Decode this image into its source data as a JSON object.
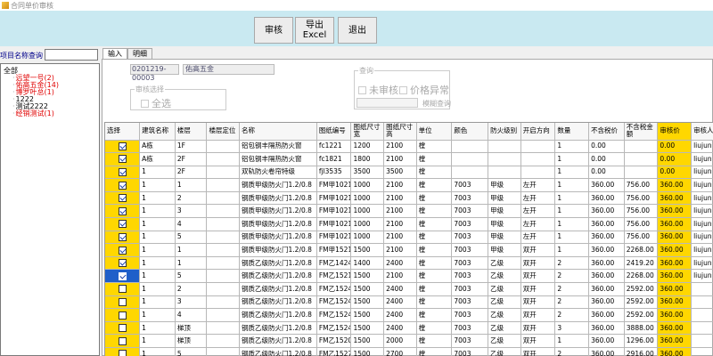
{
  "window": {
    "title": "合同单价审核"
  },
  "toolbar": {
    "audit": "审核",
    "export": "导出\nExcel",
    "exit": "退出"
  },
  "sidebar": {
    "query_label": "项目名称查询",
    "query_value": "",
    "tree": [
      {
        "label": "全部",
        "red": false,
        "level": 0
      },
      {
        "label": "远望一号(2)",
        "red": true,
        "level": 1
      },
      {
        "label": "佑高五金(14)",
        "red": true,
        "level": 1
      },
      {
        "label": "博罗叶总(1)",
        "red": true,
        "level": 1
      },
      {
        "label": "1222",
        "red": false,
        "level": 1
      },
      {
        "label": "测试2222",
        "red": false,
        "level": 1
      },
      {
        "label": "经销测试(1)",
        "red": true,
        "level": 1
      }
    ]
  },
  "tabs": [
    {
      "label": "输入",
      "active": true
    },
    {
      "label": "明细",
      "active": false
    }
  ],
  "form": {
    "contract_code": "0201219-00003",
    "project_name": "佑高五金",
    "audit_group": "审核选择",
    "select_all": "全选",
    "query_group": "查询",
    "unaudited": "未审核",
    "price_abnormal": "价格异常",
    "fuzzy_query": "模糊查询"
  },
  "grid": {
    "columns": [
      "选择",
      "建筑名称",
      "楼层",
      "楼层定位",
      "名称",
      "图纸编号",
      "图纸尺寸宽",
      "图纸尺寸高",
      "单位",
      "颜色",
      "防火级别",
      "开启方向",
      "数量",
      "不含税价",
      "不含税金额",
      "审核价",
      "审核人"
    ],
    "rows": [
      {
        "checked": true,
        "selected": false,
        "cells": [
          "A栋",
          "1F",
          "",
          "铝包钢丰隔热防火窗",
          "fc1221",
          "1200",
          "2100",
          "樘",
          "",
          "",
          "",
          "1",
          "0.00",
          "",
          "0.00",
          "liujun"
        ]
      },
      {
        "checked": true,
        "selected": false,
        "cells": [
          "A栋",
          "2F",
          "",
          "铝包钢丰隔热防火窗",
          "fc1821",
          "1800",
          "2100",
          "樘",
          "",
          "",
          "",
          "1",
          "0.00",
          "",
          "0.00",
          "liujun"
        ]
      },
      {
        "checked": true,
        "selected": false,
        "cells": [
          "1",
          "2F",
          "",
          "双轨防火卷帘特级",
          "fjl3535",
          "3500",
          "3500",
          "樘",
          "",
          "",
          "",
          "1",
          "0.00",
          "",
          "0.00",
          "liujun"
        ]
      },
      {
        "checked": true,
        "selected": false,
        "cells": [
          "1",
          "1",
          "",
          "钢质甲级防火门1.2/0.8",
          "FM甲1021",
          "1000",
          "2100",
          "樘",
          "7003",
          "甲级",
          "左开",
          "1",
          "360.00",
          "756.00",
          "360.00",
          "liujun"
        ]
      },
      {
        "checked": true,
        "selected": false,
        "cells": [
          "1",
          "2",
          "",
          "钢质甲级防火门1.2/0.8",
          "FM甲1021",
          "1000",
          "2100",
          "樘",
          "7003",
          "甲级",
          "左开",
          "1",
          "360.00",
          "756.00",
          "360.00",
          "liujun"
        ]
      },
      {
        "checked": true,
        "selected": false,
        "cells": [
          "1",
          "3",
          "",
          "钢质甲级防火门1.2/0.8",
          "FM甲1021",
          "1000",
          "2100",
          "樘",
          "7003",
          "甲级",
          "左开",
          "1",
          "360.00",
          "756.00",
          "360.00",
          "liujun"
        ]
      },
      {
        "checked": true,
        "selected": false,
        "cells": [
          "1",
          "4",
          "",
          "钢质甲级防火门1.2/0.8",
          "FM甲1021",
          "1000",
          "2100",
          "樘",
          "7003",
          "甲级",
          "左开",
          "1",
          "360.00",
          "756.00",
          "360.00",
          "liujun"
        ]
      },
      {
        "checked": true,
        "selected": false,
        "cells": [
          "1",
          "5",
          "",
          "钢质甲级防火门1.2/0.8",
          "FM甲1021",
          "1000",
          "2100",
          "樘",
          "7003",
          "甲级",
          "左开",
          "1",
          "360.00",
          "756.00",
          "360.00",
          "liujun"
        ]
      },
      {
        "checked": true,
        "selected": false,
        "cells": [
          "1",
          "1",
          "",
          "钢质甲级防火门1.2/0.8",
          "FM甲1521",
          "1500",
          "2100",
          "樘",
          "7003",
          "甲级",
          "双开",
          "1",
          "360.00",
          "2268.00",
          "360.00",
          "liujun"
        ]
      },
      {
        "checked": true,
        "selected": false,
        "cells": [
          "1",
          "1",
          "",
          "钢质乙级防火门1.2/0.8",
          "FM乙1424",
          "1400",
          "2400",
          "樘",
          "7003",
          "乙级",
          "双开",
          "2",
          "360.00",
          "2419.20",
          "360.00",
          "liujun"
        ]
      },
      {
        "checked": true,
        "selected": true,
        "cells": [
          "1",
          "5",
          "",
          "钢质乙级防火门1.2/0.8",
          "FM乙1521",
          "1500",
          "2100",
          "樘",
          "7003",
          "乙级",
          "双开",
          "2",
          "360.00",
          "2268.00",
          "360.00",
          "liujun"
        ]
      },
      {
        "checked": false,
        "selected": false,
        "cells": [
          "1",
          "2",
          "",
          "钢质乙级防火门1.2/0.8",
          "FM乙1524",
          "1500",
          "2400",
          "樘",
          "7003",
          "乙级",
          "双开",
          "2",
          "360.00",
          "2592.00",
          "360.00",
          ""
        ]
      },
      {
        "checked": false,
        "selected": false,
        "cells": [
          "1",
          "3",
          "",
          "钢质乙级防火门1.2/0.8",
          "FM乙1524",
          "1500",
          "2400",
          "樘",
          "7003",
          "乙级",
          "双开",
          "2",
          "360.00",
          "2592.00",
          "360.00",
          ""
        ]
      },
      {
        "checked": false,
        "selected": false,
        "cells": [
          "1",
          "4",
          "",
          "钢质乙级防火门1.2/0.8",
          "FM乙1524",
          "1500",
          "2400",
          "樘",
          "7003",
          "乙级",
          "双开",
          "2",
          "360.00",
          "2592.00",
          "360.00",
          ""
        ]
      },
      {
        "checked": false,
        "selected": false,
        "cells": [
          "1",
          "梯顶",
          "",
          "钢质乙级防火门1.2/0.8",
          "FM乙1524",
          "1500",
          "2400",
          "樘",
          "7003",
          "乙级",
          "双开",
          "3",
          "360.00",
          "3888.00",
          "360.00",
          ""
        ]
      },
      {
        "checked": false,
        "selected": false,
        "cells": [
          "1",
          "梯顶",
          "",
          "钢质乙级防火门1.2/0.8",
          "FM乙1520",
          "1500",
          "2000",
          "樘",
          "7003",
          "乙级",
          "双开",
          "1",
          "360.00",
          "1296.00",
          "360.00",
          ""
        ]
      },
      {
        "checked": false,
        "selected": false,
        "cells": [
          "1",
          "5",
          "",
          "钢质乙级防火门1.2/0.8",
          "FM乙1527",
          "1500",
          "2700",
          "樘",
          "7003",
          "乙级",
          "双开",
          "2",
          "360.00",
          "2916.00",
          "360.00",
          ""
        ]
      }
    ]
  }
}
